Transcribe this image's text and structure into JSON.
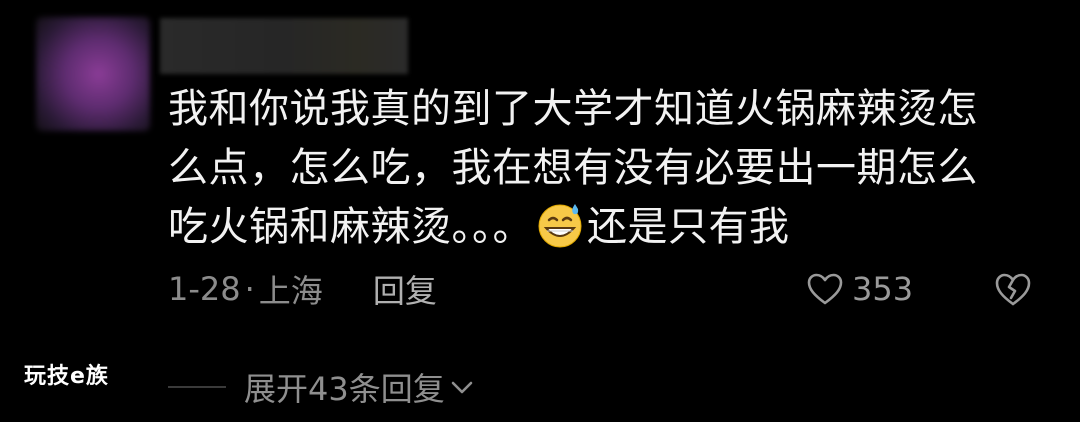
{
  "comment": {
    "text_line1": "我和你说我真的到了大学才知道火锅麻辣烫怎",
    "text_line2": "么点，怎么吃，我在想有没有必要出一期怎么",
    "text_line3_before": "吃火锅和麻辣烫。。。",
    "text_line3_emoji": "grinning-sweat-emoji",
    "text_line3_after": "还是只有我"
  },
  "meta": {
    "date": "1-28",
    "separator": "·",
    "location": "上海",
    "reply_label": "回复"
  },
  "likes": {
    "count": "353",
    "icon": "heart-outline-icon"
  },
  "dislike": {
    "icon": "broken-heart-icon"
  },
  "replies": {
    "expand_label": "展开43条回复",
    "icon": "chevron-down-icon"
  },
  "watermark": {
    "text": "玩技e族"
  },
  "colors": {
    "background": "#000000",
    "text_primary": "#f2f2f2",
    "text_secondary": "#8c8c8c"
  }
}
